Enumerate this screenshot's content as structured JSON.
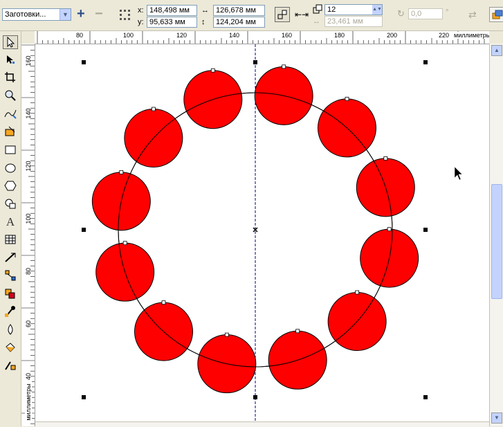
{
  "propbar": {
    "preset": "Заготовки...",
    "x_label": "x:",
    "x_value": "148,498 мм",
    "y_label": "y:",
    "y_value": "95,633 мм",
    "width_value": "126,678 мм",
    "height_value": "124,204 мм",
    "count_value": "12",
    "spacing_value": "23,461 мм",
    "angle_value": "0,0",
    "degree_symbol": "°"
  },
  "ruler": {
    "unit": "миллиметры",
    "h_ticks": [
      "80",
      "100",
      "120",
      "140",
      "160",
      "180",
      "200",
      "220"
    ],
    "v_ticks": [
      "160",
      "140",
      "120",
      "100",
      "80",
      "60",
      "40"
    ],
    "v_unit": "миллиметры"
  },
  "colors": {
    "circle_fill": "#ff0000",
    "guide": "#00008b"
  },
  "icons": {
    "toolbox": [
      "pick-tool-icon",
      "shape-tool-icon",
      "crop-tool-icon",
      "zoom-tool-icon",
      "freehand-tool-icon",
      "smart-fill-icon",
      "rectangle-tool-icon",
      "ellipse-tool-icon",
      "polygon-tool-icon",
      "basic-shapes-icon",
      "text-tool-icon",
      "table-tool-icon",
      "dimension-tool-icon",
      "connector-tool-icon",
      "blend-tool-icon",
      "eyedropper-tool-icon",
      "outline-tool-icon",
      "fill-tool-icon",
      "interactive-fill-icon"
    ]
  }
}
